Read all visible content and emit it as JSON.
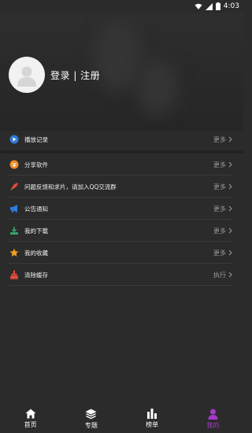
{
  "status_bar": {
    "time": "4:03"
  },
  "profile": {
    "login_text": "登录 | 注册"
  },
  "menu": [
    {
      "label": "播放记录",
      "action": "更多",
      "icon": "play-icon",
      "color": "#2f7bd6"
    },
    {
      "label": "分享软件",
      "action": "更多",
      "icon": "share-icon",
      "color": "#f08c2a"
    },
    {
      "label": "问题反馈和求片，请加入QQ交流群",
      "action": "更多",
      "icon": "rocket-icon",
      "color": "#e24b3d"
    },
    {
      "label": "公告通知",
      "action": "更多",
      "icon": "megaphone-icon",
      "color": "#2f7bd6"
    },
    {
      "label": "我的下载",
      "action": "更多",
      "icon": "download-icon",
      "color": "#3aa06a"
    },
    {
      "label": "我的收藏",
      "action": "更多",
      "icon": "star-icon",
      "color": "#f0a020"
    },
    {
      "label": "清除缓存",
      "action": "执行",
      "icon": "broom-icon",
      "color": "#e24b3d"
    }
  ],
  "tabs": [
    {
      "label": "首页",
      "icon": "home-icon"
    },
    {
      "label": "专题",
      "icon": "layers-icon"
    },
    {
      "label": "榜单",
      "icon": "chart-icon"
    },
    {
      "label": "我的",
      "icon": "user-icon",
      "active": true
    }
  ],
  "colors": {
    "accent": "#a43ac8",
    "background": "#2b2b2b"
  }
}
